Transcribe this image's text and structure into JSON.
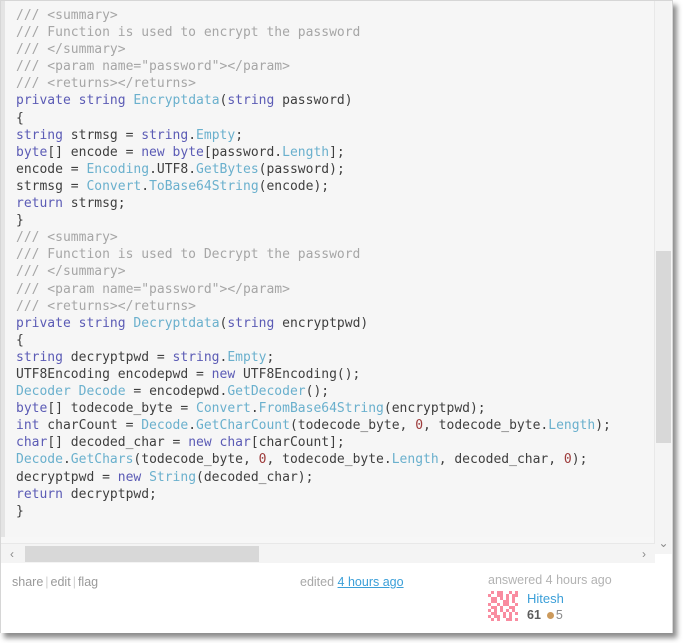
{
  "post": {
    "code_lines": [
      [
        {
          "t": "/// <summary>",
          "c": "cm"
        }
      ],
      [
        {
          "t": "/// Function is used to encrypt the password",
          "c": "cm"
        }
      ],
      [
        {
          "t": "/// </summary>",
          "c": "cm"
        }
      ],
      [
        {
          "t": "/// <param name=\"password\"></param>",
          "c": "cm"
        }
      ],
      [
        {
          "t": "/// <returns></returns>",
          "c": "cm"
        }
      ],
      [
        {
          "t": "private",
          "c": "kw"
        },
        {
          "t": " ",
          "c": "pl"
        },
        {
          "t": "string",
          "c": "kw"
        },
        {
          "t": " ",
          "c": "pl"
        },
        {
          "t": "Encryptdata",
          "c": "ty"
        },
        {
          "t": "(",
          "c": "pl"
        },
        {
          "t": "string",
          "c": "kw"
        },
        {
          "t": " password)",
          "c": "pl"
        }
      ],
      [
        {
          "t": "{",
          "c": "pl"
        }
      ],
      [
        {
          "t": "string",
          "c": "kw"
        },
        {
          "t": " strmsg = ",
          "c": "pl"
        },
        {
          "t": "string",
          "c": "kw"
        },
        {
          "t": ".",
          "c": "pl"
        },
        {
          "t": "Empty",
          "c": "ty"
        },
        {
          "t": ";",
          "c": "pl"
        }
      ],
      [
        {
          "t": "byte",
          "c": "kw"
        },
        {
          "t": "[] encode = ",
          "c": "pl"
        },
        {
          "t": "new",
          "c": "kw"
        },
        {
          "t": " ",
          "c": "pl"
        },
        {
          "t": "byte",
          "c": "kw"
        },
        {
          "t": "[password.",
          "c": "pl"
        },
        {
          "t": "Length",
          "c": "ty"
        },
        {
          "t": "];",
          "c": "pl"
        }
      ],
      [
        {
          "t": "encode = ",
          "c": "pl"
        },
        {
          "t": "Encoding",
          "c": "ty"
        },
        {
          "t": ".UTF8.",
          "c": "pl"
        },
        {
          "t": "GetBytes",
          "c": "ty"
        },
        {
          "t": "(password);",
          "c": "pl"
        }
      ],
      [
        {
          "t": "strmsg = ",
          "c": "pl"
        },
        {
          "t": "Convert",
          "c": "ty"
        },
        {
          "t": ".",
          "c": "pl"
        },
        {
          "t": "ToBase64String",
          "c": "ty"
        },
        {
          "t": "(encode);",
          "c": "pl"
        }
      ],
      [
        {
          "t": "return",
          "c": "kw"
        },
        {
          "t": " strmsg;",
          "c": "pl"
        }
      ],
      [
        {
          "t": "}",
          "c": "pl"
        }
      ],
      [
        {
          "t": "/// <summary>",
          "c": "cm"
        }
      ],
      [
        {
          "t": "/// Function is used to Decrypt the password",
          "c": "cm"
        }
      ],
      [
        {
          "t": "/// </summary>",
          "c": "cm"
        }
      ],
      [
        {
          "t": "/// <param name=\"password\"></param>",
          "c": "cm"
        }
      ],
      [
        {
          "t": "/// <returns></returns>",
          "c": "cm"
        }
      ],
      [
        {
          "t": "private",
          "c": "kw"
        },
        {
          "t": " ",
          "c": "pl"
        },
        {
          "t": "string",
          "c": "kw"
        },
        {
          "t": " ",
          "c": "pl"
        },
        {
          "t": "Decryptdata",
          "c": "ty"
        },
        {
          "t": "(",
          "c": "pl"
        },
        {
          "t": "string",
          "c": "kw"
        },
        {
          "t": " encryptpwd)",
          "c": "pl"
        }
      ],
      [
        {
          "t": "{",
          "c": "pl"
        }
      ],
      [
        {
          "t": "string",
          "c": "kw"
        },
        {
          "t": " decryptpwd = ",
          "c": "pl"
        },
        {
          "t": "string",
          "c": "kw"
        },
        {
          "t": ".",
          "c": "pl"
        },
        {
          "t": "Empty",
          "c": "ty"
        },
        {
          "t": ";",
          "c": "pl"
        }
      ],
      [
        {
          "t": "UTF8Encoding encodepwd = ",
          "c": "pl"
        },
        {
          "t": "new",
          "c": "kw"
        },
        {
          "t": " UTF8Encoding();",
          "c": "pl"
        }
      ],
      [
        {
          "t": "Decoder",
          "c": "ty"
        },
        {
          "t": " ",
          "c": "pl"
        },
        {
          "t": "Decode",
          "c": "ty"
        },
        {
          "t": " = encodepwd.",
          "c": "pl"
        },
        {
          "t": "GetDecoder",
          "c": "ty"
        },
        {
          "t": "();",
          "c": "pl"
        }
      ],
      [
        {
          "t": "byte",
          "c": "kw"
        },
        {
          "t": "[] todecode_byte = ",
          "c": "pl"
        },
        {
          "t": "Convert",
          "c": "ty"
        },
        {
          "t": ".",
          "c": "pl"
        },
        {
          "t": "FromBase64String",
          "c": "ty"
        },
        {
          "t": "(encryptpwd);",
          "c": "pl"
        }
      ],
      [
        {
          "t": "int",
          "c": "kw"
        },
        {
          "t": " charCount = ",
          "c": "pl"
        },
        {
          "t": "Decode",
          "c": "ty"
        },
        {
          "t": ".",
          "c": "pl"
        },
        {
          "t": "GetCharCount",
          "c": "ty"
        },
        {
          "t": "(todecode_byte, ",
          "c": "pl"
        },
        {
          "t": "0",
          "c": "nu"
        },
        {
          "t": ", todecode_byte.",
          "c": "pl"
        },
        {
          "t": "Length",
          "c": "ty"
        },
        {
          "t": ");",
          "c": "pl"
        }
      ],
      [
        {
          "t": "char",
          "c": "kw"
        },
        {
          "t": "[] decoded_char = ",
          "c": "pl"
        },
        {
          "t": "new",
          "c": "kw"
        },
        {
          "t": " ",
          "c": "pl"
        },
        {
          "t": "char",
          "c": "kw"
        },
        {
          "t": "[charCount];",
          "c": "pl"
        }
      ],
      [
        {
          "t": "Decode",
          "c": "ty"
        },
        {
          "t": ".",
          "c": "pl"
        },
        {
          "t": "GetChars",
          "c": "ty"
        },
        {
          "t": "(todecode_byte, ",
          "c": "pl"
        },
        {
          "t": "0",
          "c": "nu"
        },
        {
          "t": ", todecode_byte.",
          "c": "pl"
        },
        {
          "t": "Length",
          "c": "ty"
        },
        {
          "t": ", decoded_char, ",
          "c": "pl"
        },
        {
          "t": "0",
          "c": "nu"
        },
        {
          "t": ");",
          "c": "pl"
        }
      ],
      [
        {
          "t": "decryptpwd = ",
          "c": "pl"
        },
        {
          "t": "new",
          "c": "kw"
        },
        {
          "t": " ",
          "c": "pl"
        },
        {
          "t": "String",
          "c": "ty"
        },
        {
          "t": "(decoded_char);",
          "c": "pl"
        }
      ],
      [
        {
          "t": "return",
          "c": "kw"
        },
        {
          "t": " decryptpwd;",
          "c": "pl"
        }
      ],
      [
        {
          "t": "}",
          "c": "pl"
        }
      ]
    ]
  },
  "footer": {
    "share_label": "share",
    "edit_label": "edit",
    "flag_label": "flag",
    "separator": "|",
    "edited_prefix": "edited",
    "edited_time": "4 hours ago",
    "answered_text": "answered 4 hours ago",
    "username": "Hitesh",
    "reputation": "61",
    "bronze_count": "5"
  },
  "scrollbars": {
    "v_down_glyph": "⌄",
    "h_left_glyph": "‹",
    "h_right_glyph": "›"
  },
  "colors": {
    "link": "#3b9fd8",
    "comment": "#a6a6a6",
    "keyword": "#5b5bb5",
    "type": "#6ab0cd",
    "number": "#9d3b3b",
    "bronze": "#cc9a5c",
    "avatar": "#f98ca0"
  }
}
